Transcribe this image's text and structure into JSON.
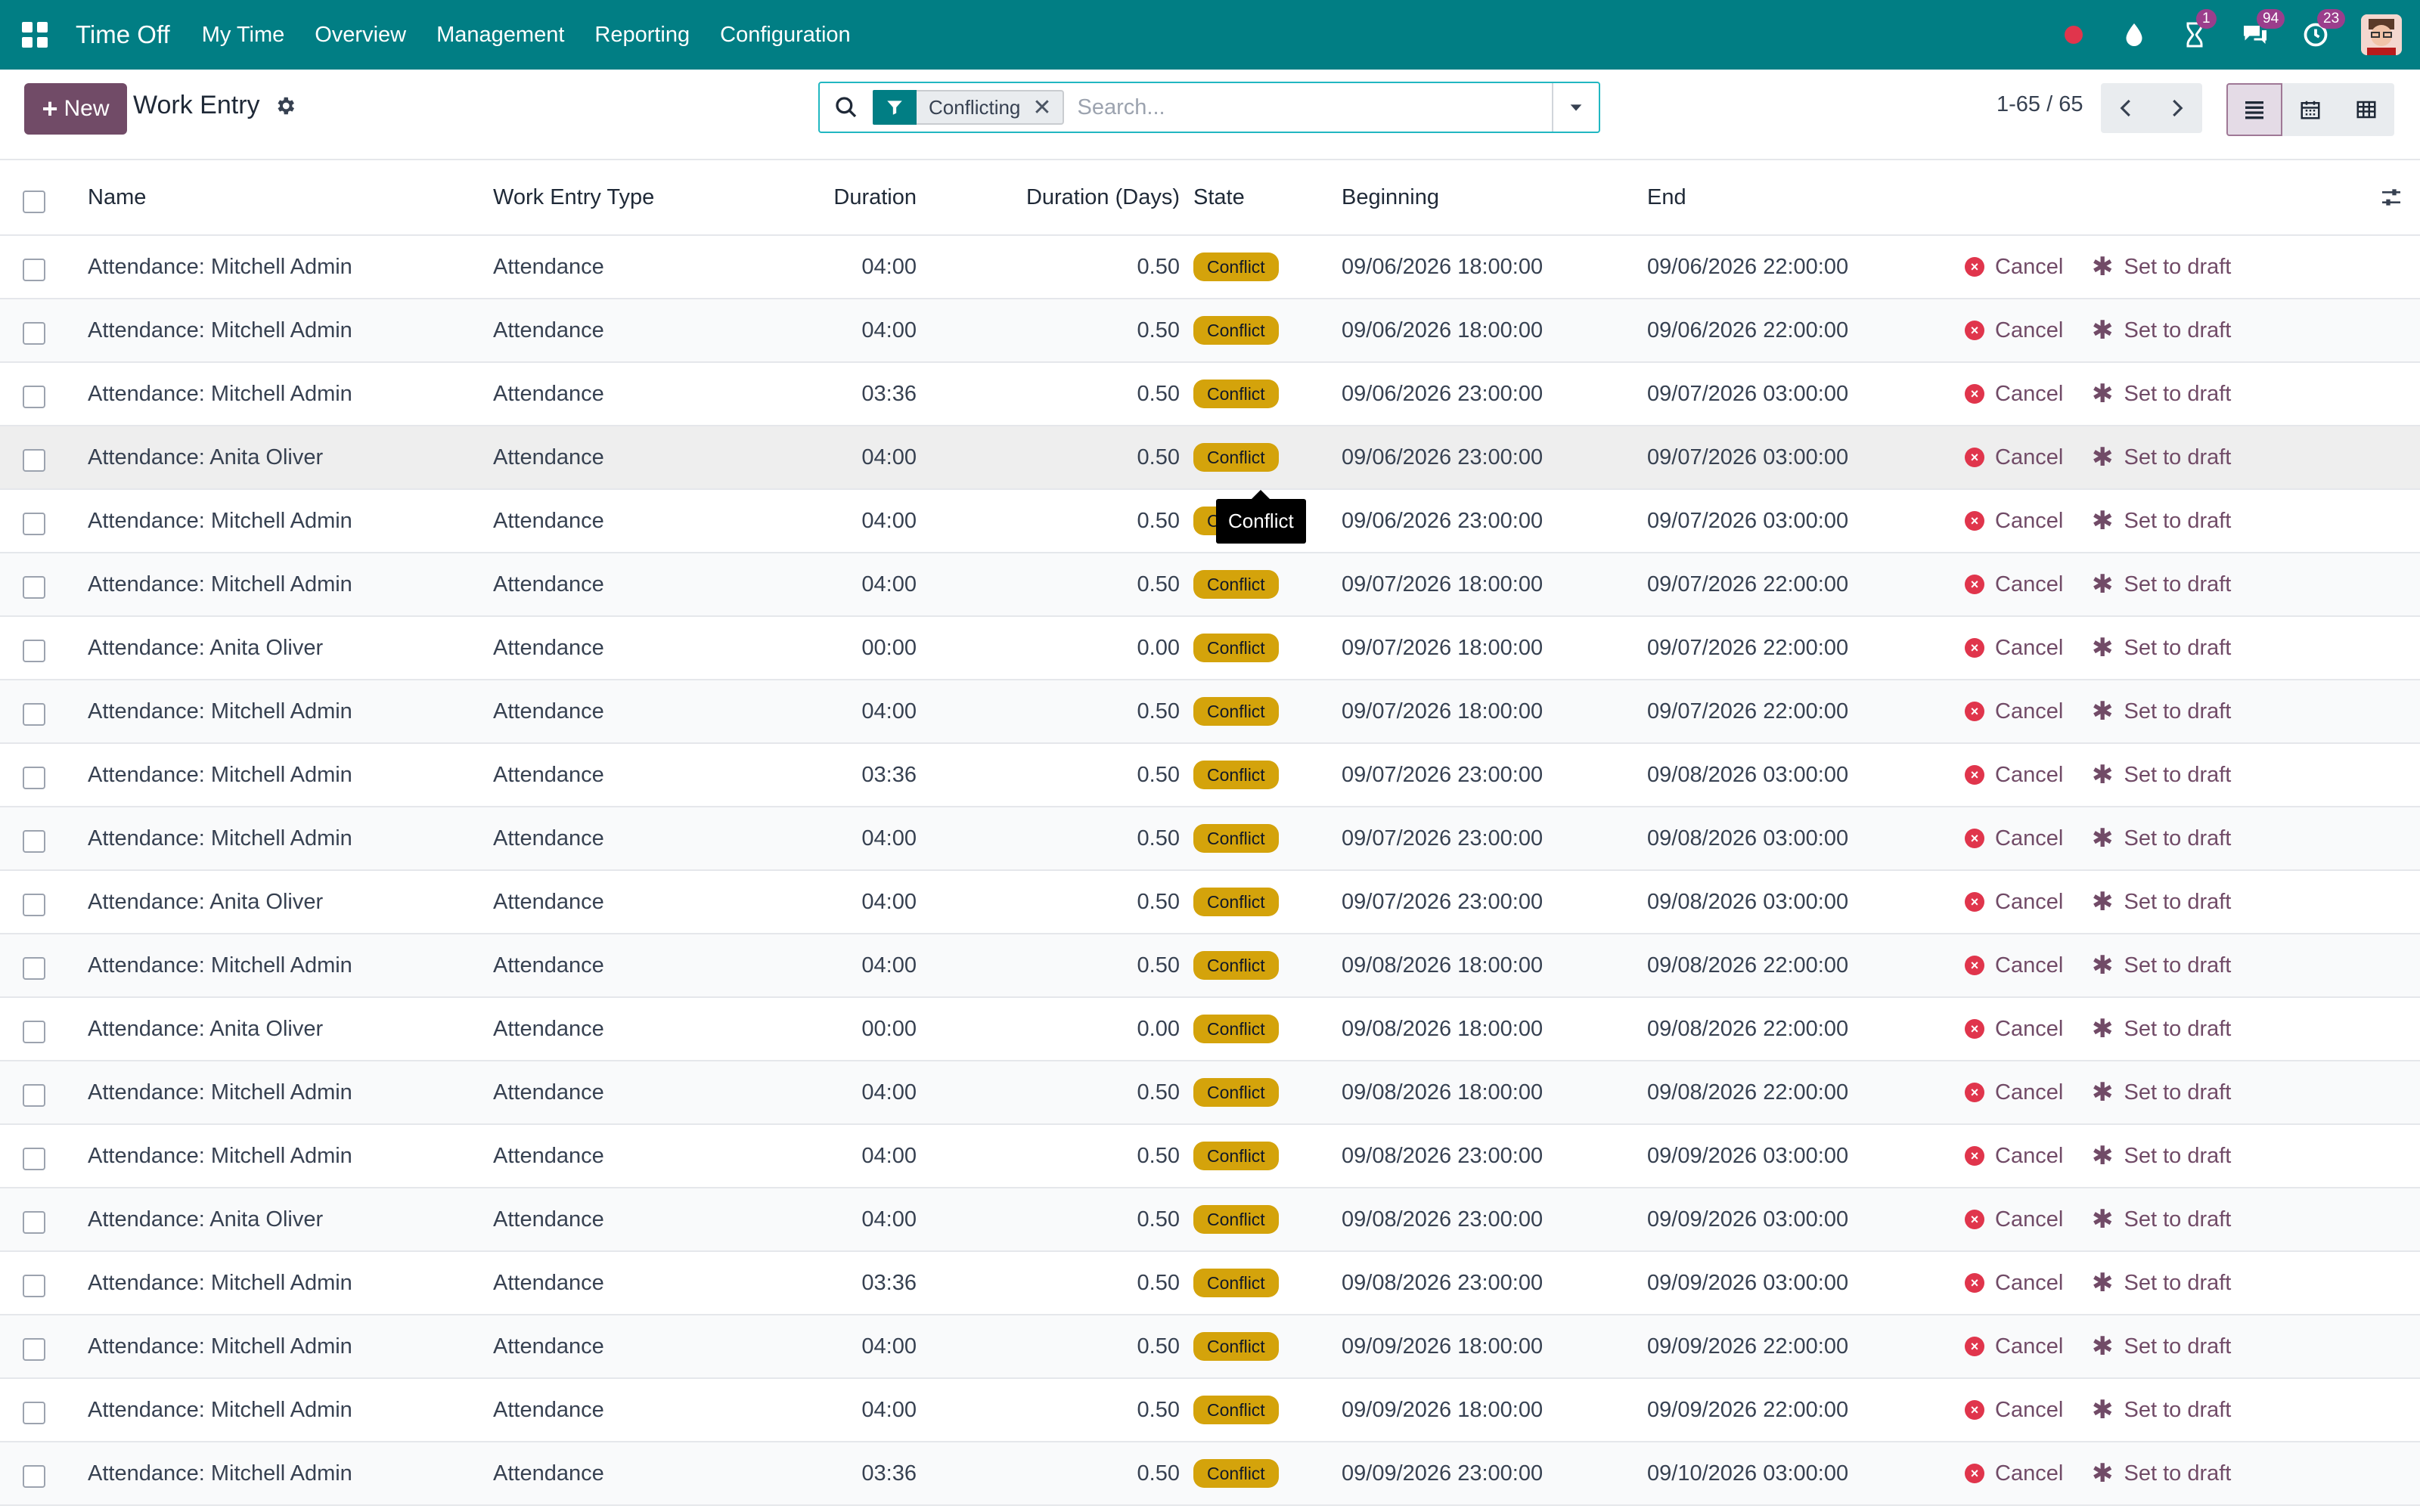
{
  "navbar": {
    "brand": "Time Off",
    "menu": [
      "My Time",
      "Overview",
      "Management",
      "Reporting",
      "Configuration"
    ],
    "systray": {
      "activity_count": "1",
      "messages_count": "94",
      "clock_count": "23"
    },
    "accent_color": "#017e84"
  },
  "control": {
    "new_label": "New",
    "title": "Work Entry",
    "search": {
      "facet_label": "Conflicting",
      "placeholder": "Search..."
    },
    "pager": "1-65 / 65"
  },
  "table": {
    "columns": {
      "name": "Name",
      "type": "Work Entry Type",
      "duration": "Duration",
      "duration_days": "Duration (Days)",
      "state": "State",
      "beginning": "Beginning",
      "end": "End"
    },
    "actions": {
      "cancel": "Cancel",
      "set_to_draft": "Set to draft"
    },
    "rows": [
      {
        "name": "Attendance: Mitchell Admin",
        "type": "Attendance",
        "duration": "04:00",
        "days": "0.50",
        "state": "Conflict",
        "begin": "09/06/2026 18:00:00",
        "end": "09/06/2026 22:00:00"
      },
      {
        "name": "Attendance: Mitchell Admin",
        "type": "Attendance",
        "duration": "04:00",
        "days": "0.50",
        "state": "Conflict",
        "begin": "09/06/2026 18:00:00",
        "end": "09/06/2026 22:00:00"
      },
      {
        "name": "Attendance: Mitchell Admin",
        "type": "Attendance",
        "duration": "03:36",
        "days": "0.50",
        "state": "Conflict",
        "begin": "09/06/2026 23:00:00",
        "end": "09/07/2026 03:00:00"
      },
      {
        "name": "Attendance: Anita Oliver",
        "type": "Attendance",
        "duration": "04:00",
        "days": "0.50",
        "state": "Conflict",
        "begin": "09/06/2026 23:00:00",
        "end": "09/07/2026 03:00:00"
      },
      {
        "name": "Attendance: Mitchell Admin",
        "type": "Attendance",
        "duration": "04:00",
        "days": "0.50",
        "state": "Conflict",
        "begin": "09/06/2026 23:00:00",
        "end": "09/07/2026 03:00:00"
      },
      {
        "name": "Attendance: Mitchell Admin",
        "type": "Attendance",
        "duration": "04:00",
        "days": "0.50",
        "state": "Conflict",
        "begin": "09/07/2026 18:00:00",
        "end": "09/07/2026 22:00:00"
      },
      {
        "name": "Attendance: Anita Oliver",
        "type": "Attendance",
        "duration": "00:00",
        "days": "0.00",
        "state": "Conflict",
        "begin": "09/07/2026 18:00:00",
        "end": "09/07/2026 22:00:00"
      },
      {
        "name": "Attendance: Mitchell Admin",
        "type": "Attendance",
        "duration": "04:00",
        "days": "0.50",
        "state": "Conflict",
        "begin": "09/07/2026 18:00:00",
        "end": "09/07/2026 22:00:00"
      },
      {
        "name": "Attendance: Mitchell Admin",
        "type": "Attendance",
        "duration": "03:36",
        "days": "0.50",
        "state": "Conflict",
        "begin": "09/07/2026 23:00:00",
        "end": "09/08/2026 03:00:00"
      },
      {
        "name": "Attendance: Mitchell Admin",
        "type": "Attendance",
        "duration": "04:00",
        "days": "0.50",
        "state": "Conflict",
        "begin": "09/07/2026 23:00:00",
        "end": "09/08/2026 03:00:00"
      },
      {
        "name": "Attendance: Anita Oliver",
        "type": "Attendance",
        "duration": "04:00",
        "days": "0.50",
        "state": "Conflict",
        "begin": "09/07/2026 23:00:00",
        "end": "09/08/2026 03:00:00"
      },
      {
        "name": "Attendance: Mitchell Admin",
        "type": "Attendance",
        "duration": "04:00",
        "days": "0.50",
        "state": "Conflict",
        "begin": "09/08/2026 18:00:00",
        "end": "09/08/2026 22:00:00"
      },
      {
        "name": "Attendance: Anita Oliver",
        "type": "Attendance",
        "duration": "00:00",
        "days": "0.00",
        "state": "Conflict",
        "begin": "09/08/2026 18:00:00",
        "end": "09/08/2026 22:00:00"
      },
      {
        "name": "Attendance: Mitchell Admin",
        "type": "Attendance",
        "duration": "04:00",
        "days": "0.50",
        "state": "Conflict",
        "begin": "09/08/2026 18:00:00",
        "end": "09/08/2026 22:00:00"
      },
      {
        "name": "Attendance: Mitchell Admin",
        "type": "Attendance",
        "duration": "04:00",
        "days": "0.50",
        "state": "Conflict",
        "begin": "09/08/2026 23:00:00",
        "end": "09/09/2026 03:00:00"
      },
      {
        "name": "Attendance: Anita Oliver",
        "type": "Attendance",
        "duration": "04:00",
        "days": "0.50",
        "state": "Conflict",
        "begin": "09/08/2026 23:00:00",
        "end": "09/09/2026 03:00:00"
      },
      {
        "name": "Attendance: Mitchell Admin",
        "type": "Attendance",
        "duration": "03:36",
        "days": "0.50",
        "state": "Conflict",
        "begin": "09/08/2026 23:00:00",
        "end": "09/09/2026 03:00:00"
      },
      {
        "name": "Attendance: Mitchell Admin",
        "type": "Attendance",
        "duration": "04:00",
        "days": "0.50",
        "state": "Conflict",
        "begin": "09/09/2026 18:00:00",
        "end": "09/09/2026 22:00:00"
      },
      {
        "name": "Attendance: Mitchell Admin",
        "type": "Attendance",
        "duration": "04:00",
        "days": "0.50",
        "state": "Conflict",
        "begin": "09/09/2026 18:00:00",
        "end": "09/09/2026 22:00:00"
      },
      {
        "name": "Attendance: Mitchell Admin",
        "type": "Attendance",
        "duration": "03:36",
        "days": "0.50",
        "state": "Conflict",
        "begin": "09/09/2026 23:00:00",
        "end": "09/10/2026 03:00:00"
      }
    ]
  },
  "tooltip": {
    "text": "Conflict"
  },
  "colors": {
    "brand": "#714b67",
    "warning": "#d4a30b",
    "danger": "#e0354c"
  }
}
